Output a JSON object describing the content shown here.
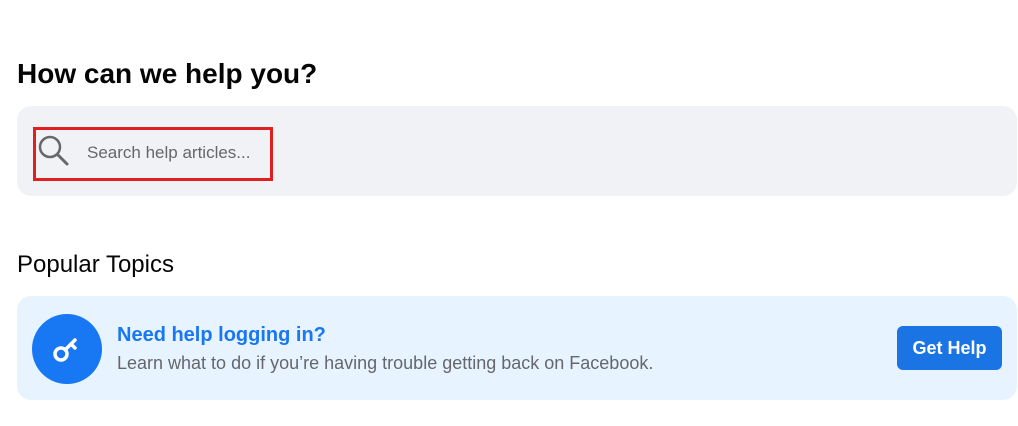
{
  "header": {
    "title": "How can we help you?"
  },
  "search": {
    "placeholder": "Search help articles...",
    "icon": "search-icon"
  },
  "popular_topics": {
    "title": "Popular Topics",
    "items": [
      {
        "icon": "key-icon",
        "title": "Need help logging in?",
        "description": "Learn what to do if you’re having trouble getting back on Facebook.",
        "button_label": "Get Help"
      }
    ]
  },
  "colors": {
    "accent": "#1877f2",
    "button": "#1b74e4",
    "search_background": "#f0f2f5",
    "card_background": "#e7f3ff",
    "highlight": "#e02020"
  }
}
